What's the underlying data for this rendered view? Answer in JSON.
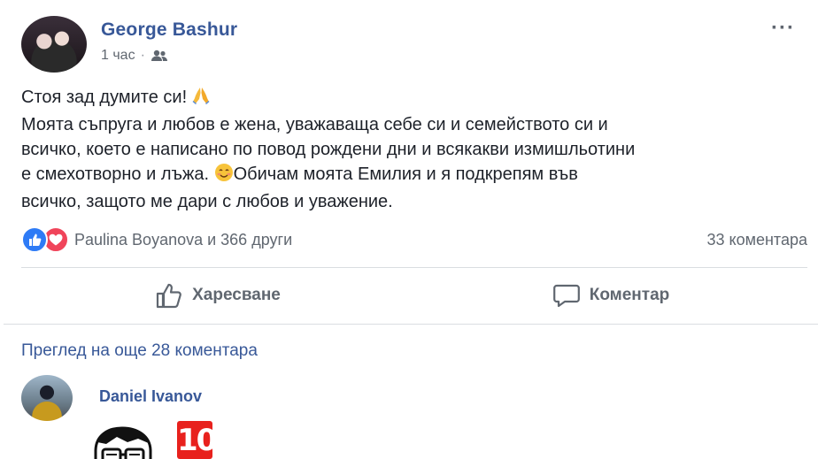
{
  "post": {
    "author": "George Bashur",
    "time": "1 час",
    "meta_separator": "·",
    "audience_icon": "friends-icon",
    "more_options": "···",
    "text_lines": [
      "Стоя зад думите си! ",
      "Моята съпруга и любов е жена, уважаваща себе си и семейството си и",
      "всичко, което е написано по повод рождени дни и всякакви измишльотини",
      "е смехотворно и лъжа. ",
      "Обичам моята Емилия и я подкрепям във",
      "всичко, защото ме дари с любов и уважение."
    ],
    "emojis": [
      "folded-hands-emoji",
      "smiling-face-emoji"
    ]
  },
  "reactions": {
    "icons": [
      "like-reaction-icon",
      "love-reaction-icon"
    ],
    "summary": "Paulina Boyanova и 366 други",
    "comments_count": "33 коментара"
  },
  "actions": {
    "like_label": "Харесване",
    "comment_label": "Коментар"
  },
  "comments": {
    "view_more": "Преглед на още 28 коментара",
    "items": [
      {
        "author": "Daniel Ivanov",
        "sticker_text": "10"
      }
    ]
  },
  "colors": {
    "link_blue": "#385898",
    "meta_gray": "#606770",
    "like_blue": "#2e7bf6",
    "love_red": "#f0445a",
    "sticker_red": "#e8211d"
  }
}
